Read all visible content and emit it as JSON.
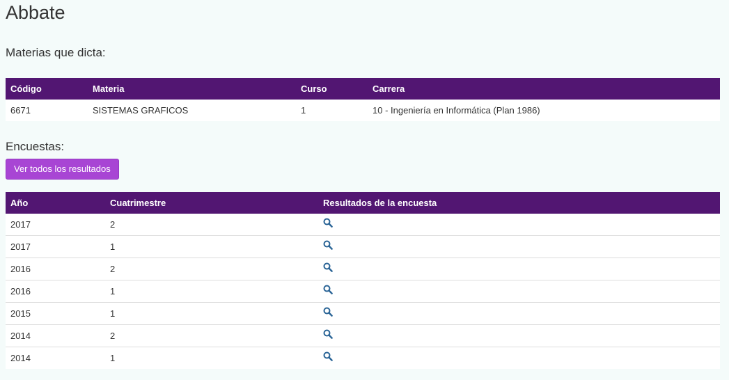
{
  "page": {
    "title": "Abbate"
  },
  "materias": {
    "heading": "Materias que dicta:",
    "columns": [
      "Código",
      "Materia",
      "Curso",
      "Carrera"
    ],
    "rows": [
      [
        "6671",
        "SISTEMAS GRAFICOS",
        "1",
        "10 - Ingeniería en Informática (Plan 1986)"
      ]
    ]
  },
  "encuestas": {
    "heading": "Encuestas:",
    "button_label": "Ver todos los resultados",
    "columns": [
      "Año",
      "Cuatrimestre",
      "Resultados de la encuesta"
    ],
    "result_icon": "search-icon",
    "rows": [
      [
        "2017",
        "2"
      ],
      [
        "2017",
        "1"
      ],
      [
        "2016",
        "2"
      ],
      [
        "2016",
        "1"
      ],
      [
        "2015",
        "1"
      ],
      [
        "2014",
        "2"
      ],
      [
        "2014",
        "1"
      ]
    ]
  },
  "colors": {
    "header_bg": "#521672",
    "button_bg": "#a845d4",
    "icon": "#2a6496",
    "page_bg": "#f4fbfa"
  }
}
